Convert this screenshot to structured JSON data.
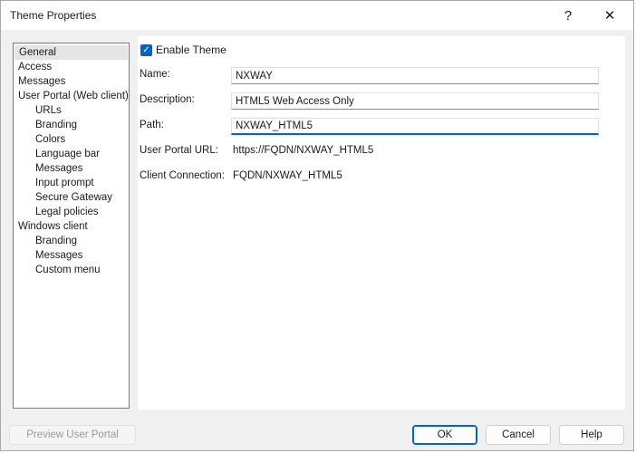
{
  "window": {
    "title": "Theme Properties",
    "help_glyph": "?",
    "close_glyph": "✕"
  },
  "nav": {
    "items": [
      {
        "label": "General",
        "level": 0,
        "selected": true
      },
      {
        "label": "Access",
        "level": 0
      },
      {
        "label": "Messages",
        "level": 0
      },
      {
        "label": "User Portal (Web client)",
        "level": 0
      },
      {
        "label": "URLs",
        "level": 1
      },
      {
        "label": "Branding",
        "level": 1
      },
      {
        "label": "Colors",
        "level": 1
      },
      {
        "label": "Language bar",
        "level": 1
      },
      {
        "label": "Messages",
        "level": 1
      },
      {
        "label": "Input prompt",
        "level": 1
      },
      {
        "label": "Secure Gateway",
        "level": 1
      },
      {
        "label": "Legal policies",
        "level": 1
      },
      {
        "label": "Windows client",
        "level": 0
      },
      {
        "label": "Branding",
        "level": 1
      },
      {
        "label": "Messages",
        "level": 1
      },
      {
        "label": "Custom menu",
        "level": 1
      }
    ]
  },
  "general": {
    "enable_theme_label": "Enable Theme",
    "enable_theme_checked": true,
    "name_label": "Name:",
    "name_value": "NXWAY",
    "description_label": "Description:",
    "description_value": "HTML5 Web Access Only",
    "path_label": "Path:",
    "path_value": "NXWAY_HTML5",
    "portal_url_label": "User Portal URL:",
    "portal_url_value": "https://FQDN/NXWAY_HTML5",
    "client_connection_label": "Client Connection:",
    "client_connection_value": "FQDN/NXWAY_HTML5"
  },
  "footer": {
    "preview_label": "Preview User Portal",
    "ok_label": "OK",
    "cancel_label": "Cancel",
    "help_label": "Help"
  },
  "colors": {
    "accent": "#0067c0",
    "selection": "#e5e5e5"
  }
}
